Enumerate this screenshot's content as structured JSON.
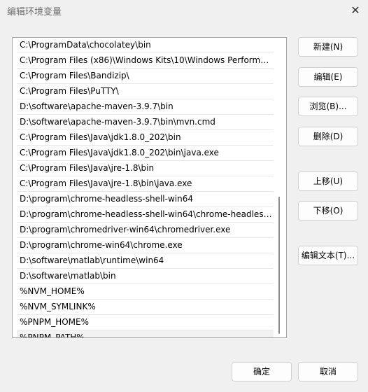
{
  "window": {
    "title": "编辑环境变量",
    "close_glyph": "✕"
  },
  "paths": [
    "C:\\ProgramData\\chocolatey\\bin",
    "C:\\Program Files (x86)\\Windows Kits\\10\\Windows Performan...",
    "C:\\Program Files\\Bandizip\\",
    "C:\\Program Files\\PuTTY\\",
    "D:\\software\\apache-maven-3.9.7\\bin",
    "D:\\software\\apache-maven-3.9.7\\bin\\mvn.cmd",
    "C:\\Program Files\\Java\\jdk1.8.0_202\\bin",
    "C:\\Program Files\\Java\\jdk1.8.0_202\\bin\\java.exe",
    "C:\\Program Files\\Java\\jre-1.8\\bin",
    "C:\\Program Files\\Java\\jre-1.8\\bin\\java.exe",
    "D:\\program\\chrome-headless-shell-win64",
    "D:\\program\\chrome-headless-shell-win64\\chrome-headless-...",
    "D:\\program\\chromedriver-win64\\chromedriver.exe",
    "D:\\program\\chrome-win64\\chrome.exe",
    "D:\\software\\matlab\\runtime\\win64",
    "D:\\software\\matlab\\bin",
    "%NVM_HOME%",
    "%NVM_SYMLINK%",
    "%PNPM_HOME%",
    "%PNPM_PATH%"
  ],
  "buttons": {
    "new": "新建(N)",
    "edit": "编辑(E)",
    "browse": "浏览(B)...",
    "delete": "删除(D)",
    "move_up": "上移(U)",
    "move_down": "下移(O)",
    "edit_text": "编辑文本(T)...",
    "ok": "确定",
    "cancel": "取消"
  }
}
